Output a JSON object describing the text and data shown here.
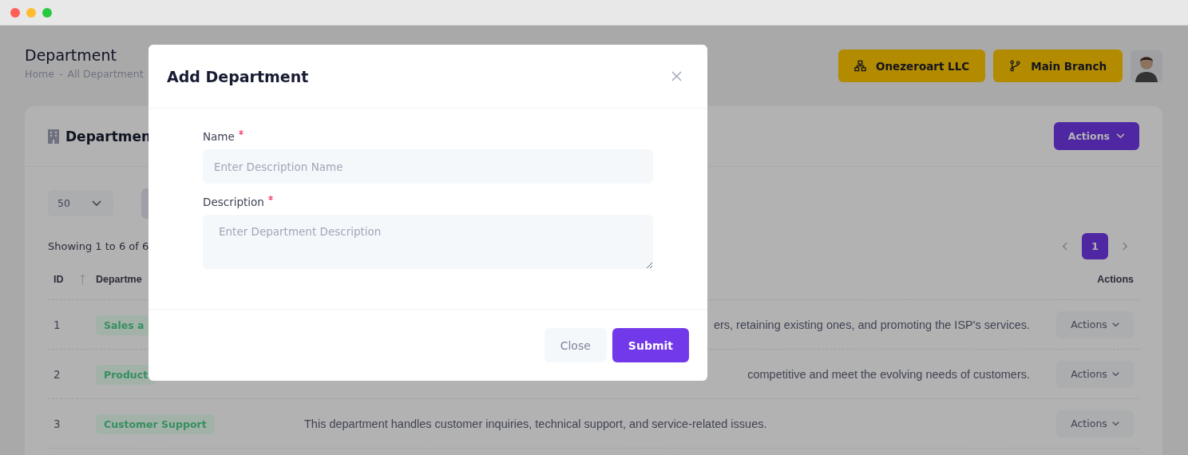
{
  "page": {
    "title": "Department",
    "breadcrumb": [
      "Home",
      "-",
      "All Department"
    ],
    "company_button": "Onezeroart LLC",
    "branch_button": "Main Branch"
  },
  "card": {
    "title": "Departmen",
    "actions_button": "Actions",
    "page_size": "50",
    "showing": "Showing 1 to 6 of 6",
    "pages": [
      {
        "label": "1",
        "selected": true
      }
    ],
    "columns": [
      "ID",
      "Departme",
      "Actions"
    ],
    "rows": [
      {
        "id": "1",
        "department": "Sales a",
        "description": "ers, retaining existing ones, and promoting the ISP's services.",
        "description_cut": true,
        "action": "Actions"
      },
      {
        "id": "2",
        "department": "Product",
        "description": "competitive and meet the evolving needs of customers.",
        "description_cut": true,
        "action": "Actions"
      },
      {
        "id": "3",
        "department": "Customer Support",
        "description": "This department handles customer inquiries, technical support, and service-related issues.",
        "description_cut": false,
        "action": "Actions"
      }
    ]
  },
  "modal": {
    "title": "Add Department",
    "fields": [
      {
        "kind": "input",
        "label": "Name",
        "required": true,
        "placeholder": "Enter Description Name"
      },
      {
        "kind": "textarea",
        "label": "Description",
        "required": true,
        "placeholder": "Enter Department Description"
      }
    ],
    "buttons": [
      {
        "label": "Close",
        "kind": "secondary"
      },
      {
        "label": "Submit",
        "kind": "primary"
      }
    ]
  }
}
